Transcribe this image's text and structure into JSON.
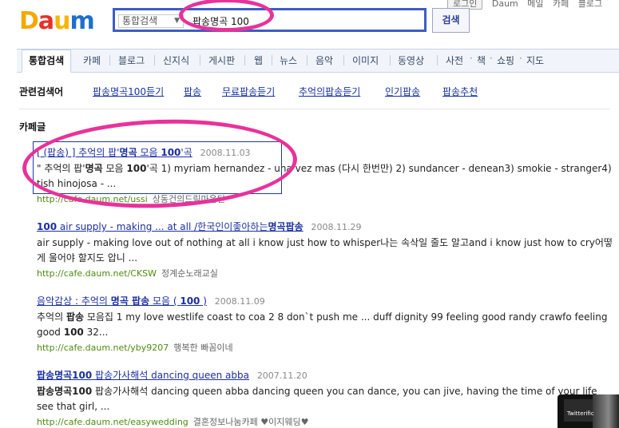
{
  "top_util": {
    "login": "로그인",
    "daum": "Daum",
    "mail": "메일",
    "cafe": "카페",
    "blog": "블로그"
  },
  "logo": {
    "d": "D",
    "a": "a",
    "u": "u",
    "m": "m"
  },
  "search": {
    "scope": "통합검색",
    "query": "팝송명곡 100",
    "button": "검색"
  },
  "tabs": [
    {
      "label": "통합검색",
      "active": true
    },
    {
      "label": "카페"
    },
    {
      "label": "블로그"
    },
    {
      "label": "신지식"
    },
    {
      "label": "게시판"
    },
    {
      "label": "웹"
    },
    {
      "label": "뉴스"
    },
    {
      "label": "음악"
    },
    {
      "label": "이미지"
    },
    {
      "label": "동영상"
    },
    {
      "label": "사전"
    },
    {
      "label": "책"
    },
    {
      "label": "쇼핑"
    },
    {
      "label": "지도"
    }
  ],
  "related": {
    "title": "관련검색어",
    "items": [
      "팝송명곡100듣기",
      "팝송",
      "무료팝송듣기",
      "추억의팝송듣기",
      "인기팝송",
      "팝송추천"
    ]
  },
  "cafe_section": {
    "title": "카페글"
  },
  "results": [
    {
      "title_parts": [
        "[ (팝송) ] 추억의 팝'",
        "명곡",
        " 모음 ",
        "100",
        "'곡"
      ],
      "date": "2008.11.03",
      "snippet_parts": [
        "\" 추억의 팝'",
        "명곡",
        " 모음 ",
        "100",
        "'곡 1) myriam hernandez - una vez mas (다시 한번만) 2) sundancer - denean3) smokie - stranger4) tish hinojosa - ..."
      ],
      "url": "http://cafe.daum.net/ussi",
      "cafe": "상동건의드림마운틴"
    },
    {
      "title_parts": [
        "100",
        " air supply - making ... at all /한국인이좋아하는",
        "명곡팝송"
      ],
      "date": "2008.11.29",
      "snippet_parts": [
        "air supply - making love out of nothing at all i know just how to whisper나는 속삭일 줄도 알고and i know just how to cry어떻게 울어야 할지도 압니 ..."
      ],
      "url": "http://cafe.daum.net/CKSW",
      "cafe": "정계순노래교실"
    },
    {
      "title_parts": [
        "음악감상 : 추억의 ",
        "명곡 팝송",
        " 모음 ( ",
        "100",
        " )"
      ],
      "date": "2008.11.09",
      "snippet_parts": [
        "추억의 ",
        "팝송",
        " 모음집 1 my love westlife coast to coa 2 8 don`t push me ... duff dignity 99 feeling good randy crawfo feeling good ",
        "100",
        " 32..."
      ],
      "url": "http://cafe.daum.net/yby9207",
      "cafe": "행복한 빠꼼이네"
    },
    {
      "title_parts": [
        "팝송명곡100",
        " 팝송가사해석 dancing queen abba"
      ],
      "date": "2007.11.20",
      "snippet_parts": [
        "팝송명곡100",
        " 팝송가사해석 dancing queen abba dancing queen you can dance, you can jive, having the time of your life see that girl, ..."
      ],
      "url": "http://cafe.daum.net/easywedding",
      "cafe": "결혼정보나눔카페 ♥이지웨딩♥"
    }
  ],
  "ad": {
    "label": "Twitterific"
  },
  "colors": {
    "accent": "#3b5cc8",
    "link": "#1a2fa0",
    "url": "#4f8a10",
    "annotation": "#e8329b"
  }
}
